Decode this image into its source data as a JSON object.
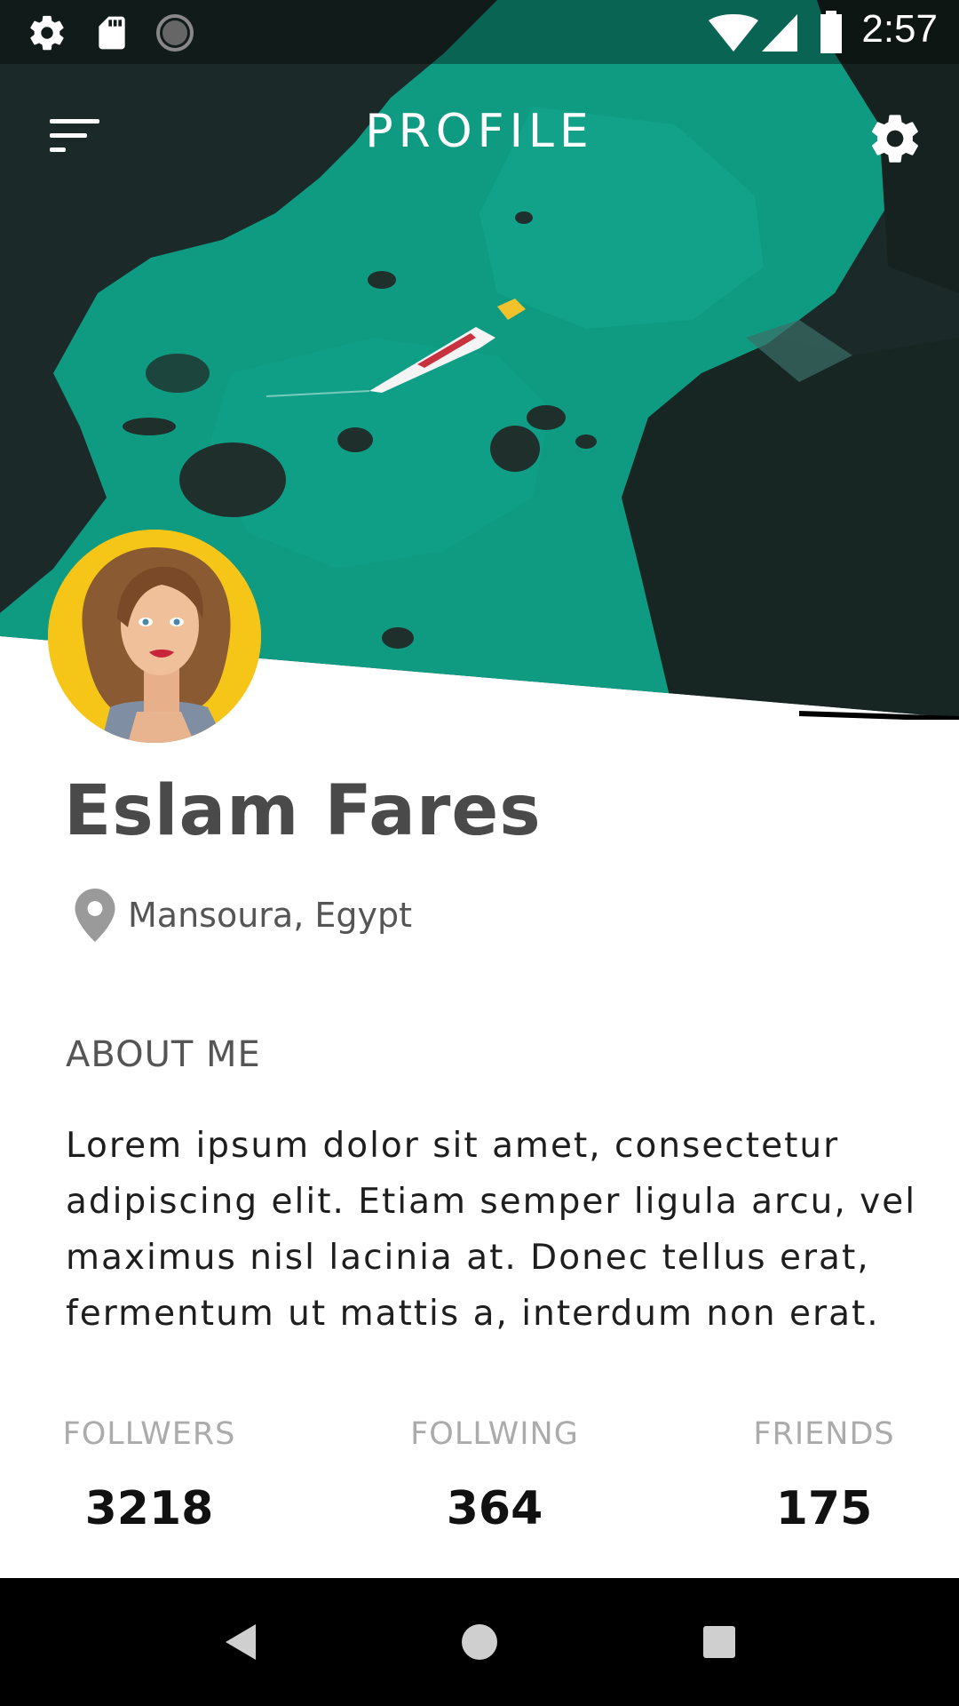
{
  "status_bar": {
    "time": "2:57",
    "left_icons": [
      "settings-icon",
      "sd-card-icon",
      "sync-icon"
    ],
    "right_icons": [
      "wifi-icon",
      "cell-signal-icon",
      "battery-icon"
    ]
  },
  "app_bar": {
    "title": "PROFILE",
    "menu_icon": "sort-menu-icon",
    "settings_icon": "gear-icon"
  },
  "profile": {
    "name": "Eslam Fares",
    "location": "Mansoura, Egypt",
    "location_icon": "location-pin-icon"
  },
  "about": {
    "title": "ABOUT ME",
    "text": "Lorem ipsum dolor sit amet, consectetur adipiscing elit. Etiam semper ligula arcu, vel maximus nisl lacinia at. Donec tellus erat, fermentum ut mattis a, interdum non erat."
  },
  "stats": [
    {
      "label": "FOLLWERS",
      "value": "3218"
    },
    {
      "label": "FOLLWING",
      "value": "364"
    },
    {
      "label": "FRIENDS",
      "value": "175"
    }
  ],
  "nav": {
    "icons": [
      "back-icon",
      "home-icon",
      "recents-icon"
    ]
  },
  "colors": {
    "sea": "#0f9a82",
    "rock": "#1b2a28",
    "avatar_bg": "#f5c518",
    "name_text": "#4a4a4a",
    "stat_label": "#ababab"
  }
}
